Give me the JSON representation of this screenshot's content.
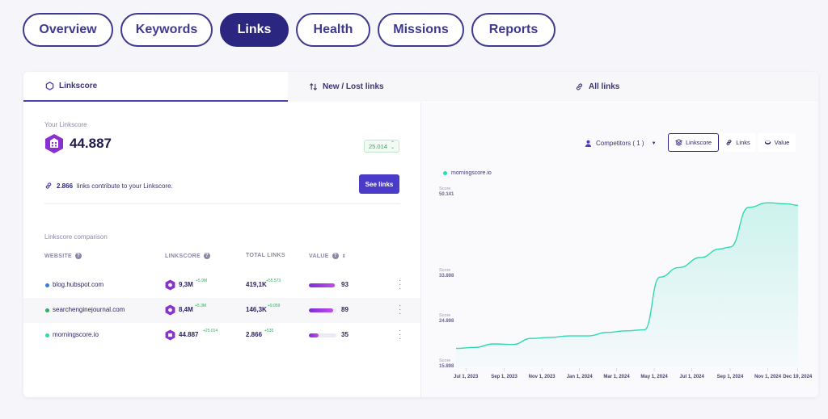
{
  "nav": {
    "tabs": [
      {
        "label": "Overview",
        "active": false
      },
      {
        "label": "Keywords",
        "active": false
      },
      {
        "label": "Links",
        "active": true
      },
      {
        "label": "Health",
        "active": false
      },
      {
        "label": "Missions",
        "active": false
      },
      {
        "label": "Reports",
        "active": false
      }
    ]
  },
  "subtabs": [
    {
      "label": "Linkscore",
      "icon": "hexagon-icon",
      "active": true
    },
    {
      "label": "New / Lost links",
      "icon": "arrows-updown-icon",
      "active": false
    },
    {
      "label": "All links",
      "icon": "link-icon",
      "active": false
    }
  ],
  "linkscore": {
    "label": "Your Linkscore",
    "value": "44.887",
    "change": "25.014",
    "contrib_count": "2.866",
    "contrib_text": "links contribute to your Linkscore.",
    "see_links": "See links"
  },
  "comparison": {
    "title": "Linkscore comparison",
    "headers": {
      "website": "WEBSITE",
      "linkscore": "LINKSCORE",
      "total_links": "TOTAL LINKS",
      "value": "VALUE"
    },
    "rows": [
      {
        "site": "blog.hubspot.com",
        "dot": "#3a7bd5",
        "linkscore": "9,3M",
        "ls_delta": "+5.9M",
        "total_links": "419,1K",
        "tl_delta": "+55.573",
        "value": "93",
        "value_fill": 0.93
      },
      {
        "site": "searchenginejournal.com",
        "dot": "#2fae5c",
        "linkscore": "8,4M",
        "ls_delta": "+5.3M",
        "total_links": "146,3K",
        "tl_delta": "+9.059",
        "value": "89",
        "value_fill": 0.89
      },
      {
        "site": "morningscore.io",
        "dot": "#2fd8b0",
        "linkscore": "44.887",
        "ls_delta": "+25.014",
        "total_links": "2.866",
        "tl_delta": "+535",
        "value": "35",
        "value_fill": 0.35
      }
    ]
  },
  "chart_controls": {
    "competitors": "Competitors ( 1 )",
    "segments": [
      {
        "label": "Linkscore",
        "active": true
      },
      {
        "label": "Links",
        "active": false
      },
      {
        "label": "Value",
        "active": false
      }
    ]
  },
  "chart_data": {
    "type": "area",
    "series": [
      {
        "name": "morningscore.io",
        "color": "#2fd8b0",
        "values": [
          19500,
          19700,
          20400,
          20300,
          21500,
          21700,
          22000,
          22000,
          22700,
          23000,
          23200,
          33700,
          35600,
          37600,
          39300,
          39700,
          47600,
          48500,
          48300,
          48000
        ]
      }
    ],
    "x": [
      "2023-06-15",
      "2023-07-15",
      "2023-08-15",
      "2023-09-15",
      "2023-10-15",
      "2023-11-15",
      "2023-12-15",
      "2024-01-15",
      "2024-02-15",
      "2024-03-15",
      "2024-04-15",
      "2024-05-10",
      "2024-06-10",
      "2024-07-15",
      "2024-08-15",
      "2024-09-01",
      "2024-10-01",
      "2024-11-01",
      "2024-12-01",
      "2024-12-20"
    ],
    "xticks": [
      "Jul 1, 2023",
      "Sep 1, 2023",
      "Nov 1, 2023",
      "Jan 1, 2024",
      "Mar 1, 2024",
      "May 1, 2024",
      "Jul 1, 2024",
      "Sep 1, 2024",
      "Nov 1, 2024",
      "Dec 19, 2024"
    ],
    "yticks": [
      {
        "caption": "Score",
        "label": "50.141",
        "value": 50141
      },
      {
        "caption": "Score",
        "label": "33.898",
        "value": 33898
      },
      {
        "caption": "Score",
        "label": "24.898",
        "value": 24898
      },
      {
        "caption": "Score",
        "label": "15.898",
        "value": 15898
      }
    ],
    "ylim": [
      15898,
      50141
    ]
  }
}
